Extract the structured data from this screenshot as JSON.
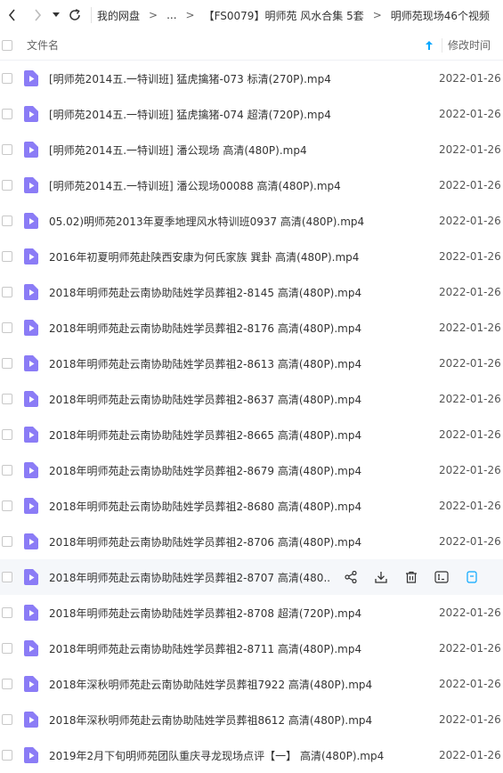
{
  "toolbar": {
    "back_icon": "chevron-left-icon",
    "forward_icon": "chevron-right-icon",
    "history_icon": "caret-down-icon",
    "refresh_icon": "refresh-icon"
  },
  "breadcrumb": {
    "items": [
      "我的网盘",
      "...",
      "【FS0079】明师苑 风水合集 5套",
      "明师苑现场46个视频"
    ],
    "separator": ">"
  },
  "table": {
    "header_name": "文件名",
    "header_date": "修改时间",
    "sort_icon": "arrow-up-icon"
  },
  "files": [
    {
      "name": "[明师苑2014五.一特训班] 猛虎擒猪-073 标清(270P).mp4",
      "date": "2022-01-26"
    },
    {
      "name": "[明师苑2014五.一特训班] 猛虎擒猪-074 超清(720P).mp4",
      "date": "2022-01-26"
    },
    {
      "name": "[明师苑2014五.一特训班] 潘公现场 高清(480P).mp4",
      "date": "2022-01-26"
    },
    {
      "name": "[明师苑2014五.一特训班] 潘公现场00088 高清(480P).mp4",
      "date": "2022-01-26"
    },
    {
      "name": "05.02)明师苑2013年夏季地理风水特训班0937 高清(480P).mp4",
      "date": "2022-01-26"
    },
    {
      "name": "2016年初夏明师苑赴陕西安康为何氏家族 巽卦 高清(480P).mp4",
      "date": "2022-01-26"
    },
    {
      "name": "2018年明师苑赴云南协助陆姓学员葬祖2-8145 高清(480P).mp4",
      "date": "2022-01-26"
    },
    {
      "name": "2018年明师苑赴云南协助陆姓学员葬祖2-8176 高清(480P).mp4",
      "date": "2022-01-26"
    },
    {
      "name": "2018年明师苑赴云南协助陆姓学员葬祖2-8613 高清(480P).mp4",
      "date": "2022-01-26"
    },
    {
      "name": "2018年明师苑赴云南协助陆姓学员葬祖2-8637 高清(480P).mp4",
      "date": "2022-01-26"
    },
    {
      "name": "2018年明师苑赴云南协助陆姓学员葬祖2-8665 高清(480P).mp4",
      "date": "2022-01-26"
    },
    {
      "name": "2018年明师苑赴云南协助陆姓学员葬祖2-8679 高清(480P).mp4",
      "date": "2022-01-26"
    },
    {
      "name": "2018年明师苑赴云南协助陆姓学员葬祖2-8680 高清(480P).mp4",
      "date": "2022-01-26"
    },
    {
      "name": "2018年明师苑赴云南协助陆姓学员葬祖2-8706 高清(480P).mp4",
      "date": "2022-01-26"
    },
    {
      "name": "2018年明师苑赴云南协助陆姓学员葬祖2-8707 高清(480...",
      "date": ""
    },
    {
      "name": "2018年明师苑赴云南协助陆姓学员葬祖2-8708 超清(720P).mp4",
      "date": "2022-01-26"
    },
    {
      "name": "2018年明师苑赴云南协助陆姓学员葬祖2-8711 高清(480P).mp4",
      "date": "2022-01-26"
    },
    {
      "name": "2018年深秋明师苑赴云南协助陆姓学员葬祖7922 高清(480P).mp4",
      "date": "2022-01-26"
    },
    {
      "name": "2018年深秋明师苑赴云南协助陆姓学员葬祖8612 高清(480P).mp4",
      "date": "2022-01-26"
    },
    {
      "name": "2019年2月下旬明师苑团队重庆寻龙现场点评【一】 高清(480P).mp4",
      "date": "2022-01-26"
    }
  ],
  "hover_actions": [
    {
      "icon": "share-icon"
    },
    {
      "icon": "download-icon"
    },
    {
      "icon": "delete-icon"
    },
    {
      "icon": "rename-icon"
    },
    {
      "icon": "more-icon"
    }
  ],
  "colors": {
    "file_icon": "#8b7cf6",
    "accent": "#06a7ff",
    "hover_row": "#f5f7fa"
  }
}
